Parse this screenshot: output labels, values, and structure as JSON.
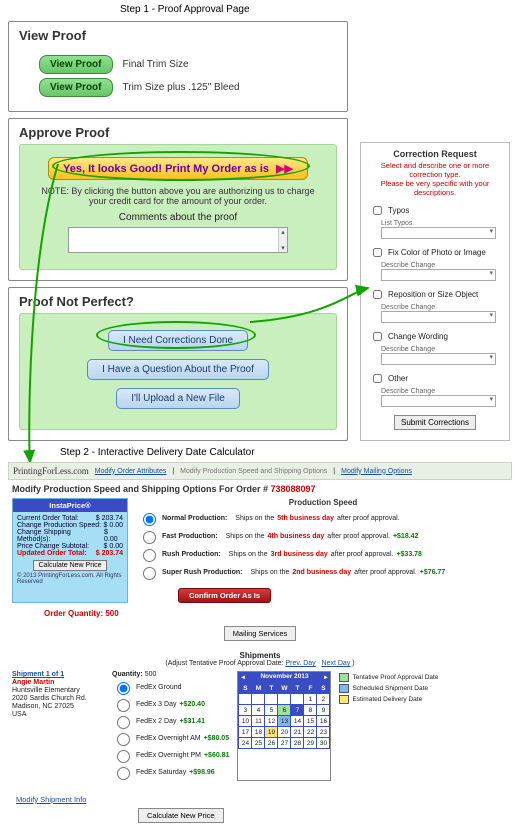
{
  "step1_label": "Step 1 - Proof Approval Page",
  "viewproof": {
    "title": "View Proof",
    "btn": "View Proof",
    "final": "Final Trim Size",
    "bleed": "Trim Size plus .125\" Bleed"
  },
  "approve": {
    "title": "Approve Proof",
    "yes_btn": "Yes, It looks Good! Print My Order as is",
    "arrows": "▶▶",
    "note": "NOTE: By clicking the button above you are authorizing us to charge your credit card for the amount of your order.",
    "comments_label": "Comments about the proof"
  },
  "notperfect": {
    "title": "Proof Not Perfect?",
    "corrections": "I Need Corrections Done",
    "question": "I Have a Question About the Proof",
    "upload": "I'll Upload a New File"
  },
  "correction_panel": {
    "title": "Correction Request",
    "red1": "Select and describe one or more correction type.",
    "red2": "Please be very specific with your descriptions.",
    "items": [
      {
        "label": "Typos",
        "sub": "List Typos"
      },
      {
        "label": "Fix Color of Photo or Image",
        "sub": "Describe Change"
      },
      {
        "label": "Reposition or Size Object",
        "sub": "Describe Change"
      },
      {
        "label": "Change Wording",
        "sub": "Describe Change"
      },
      {
        "label": "Other",
        "sub": "Describe Change"
      }
    ],
    "submit": "Submit Corrections"
  },
  "step2_label": "Step 2 - Interactive Delivery Date Calculator",
  "nav": {
    "logo": "PrintingForLess.com",
    "l1": "Modify Order Attributes",
    "l2": "Modify Production Speed and Shipping Options",
    "l3": "Modify Mailing Options"
  },
  "modify_title_pre": "Modify Production Speed and Shipping Options For Order # ",
  "order_num": "738088097",
  "insta": {
    "hd": "InstaPrice®",
    "l1k": "Current Order Total:",
    "l1v": "$  203.74",
    "l2k": "Change Production Speed:",
    "l2v": "$    0.00",
    "l3k": "Change Shipping Method(s):",
    "l3v": "$    0.00",
    "l4k": "Price Change Subtotal:",
    "l4v": "$    0.00",
    "updk": "Updated Order Total:",
    "updv": "$ 203.74",
    "calc": "Calculate New Price",
    "foot": "© 2013 PrintingForLess.com. All Rights Reserved"
  },
  "prod": {
    "title": "Production Speed",
    "o1a": "Normal Production:",
    "o1b": "Ships on the ",
    "o1c": "5th business day",
    "o1d": " after proof approval.",
    "o2a": "Fast Production:",
    "o2b": "Ships on the ",
    "o2c": "4th business day",
    "o2d": " after proof approval. ",
    "o2p": "+$18.42",
    "o3a": "Rush Production:",
    "o3b": "Ships on the ",
    "o3c": "3rd business day",
    "o3d": " after proof approval. ",
    "o3p": "+$33.78",
    "o4a": "Super Rush Production:",
    "o4b": "Ships on the ",
    "o4c": "2nd business day",
    "o4d": " after proof approval. ",
    "o4p": "+$76.77",
    "confirm": "Confirm Order As Is"
  },
  "order_qty": "Order Quantity: 500",
  "mailing_btn": "Mailing Services",
  "shipments": {
    "hdr": "Shipments",
    "sub_pre": "(Adjust Tentative Proof Approval Date: ",
    "prev": "Prev. Day",
    "next": "Next Day",
    "sub_post": ")",
    "addr_t": "Shipment 1 of 1",
    "addr": [
      "Angie Martin",
      "Huntsville Elementary",
      "2020 Sardis Church Rd.",
      "Madison, NC 27025",
      "USA"
    ],
    "qlabel": "Quantity:",
    "q": "500",
    "opts": [
      {
        "n": "FedEx Ground",
        "p": ""
      },
      {
        "n": "FedEx 3 Day",
        "p": "+$20.40"
      },
      {
        "n": "FedEx 2 Day",
        "p": "+$31.41"
      },
      {
        "n": "FedEx Overnight AM",
        "p": "+$80.05"
      },
      {
        "n": "FedEx Overnight PM",
        "p": "+$60.81"
      },
      {
        "n": "FedEx Saturday",
        "p": "+$98.96"
      }
    ],
    "cal_month": "November 2013",
    "legend": [
      {
        "c": "#9be29b",
        "t": "Tentative Proof Approval Date"
      },
      {
        "c": "#7fb8ef",
        "t": "Scheduled Shipment Date"
      },
      {
        "c": "#ffe477",
        "t": "Estimated Delivery Date"
      }
    ]
  },
  "modship": "Modify Shipment Info",
  "calc2": "Calculate New Price"
}
